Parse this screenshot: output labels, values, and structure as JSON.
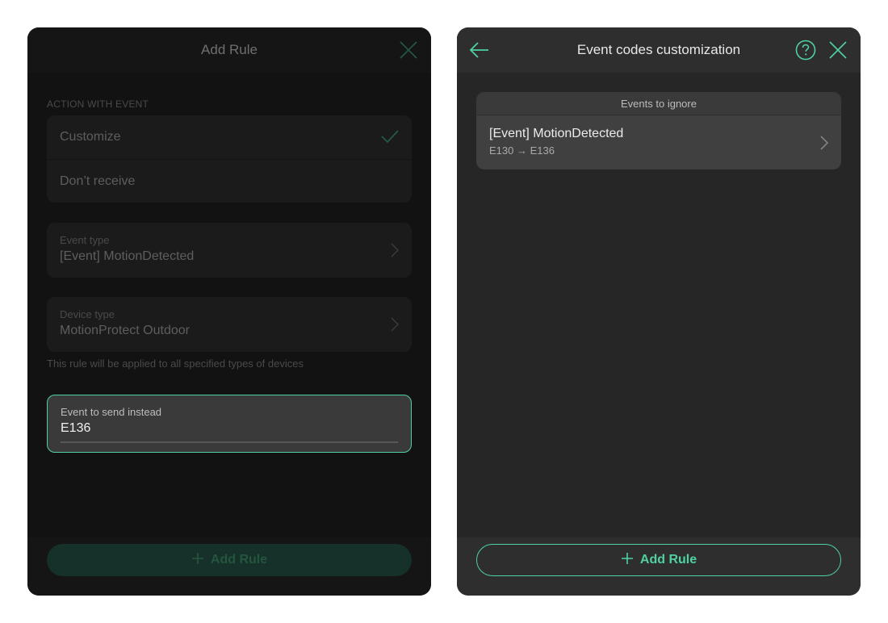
{
  "add_rule_panel": {
    "title": "Add Rule",
    "section_label": "ACTION WITH EVENT",
    "options": [
      {
        "label": "Customize",
        "selected": true
      },
      {
        "label": "Don’t receive",
        "selected": false
      }
    ],
    "event_type": {
      "label": "Event type",
      "value": "[Event] MotionDetected"
    },
    "device_type": {
      "label": "Device type",
      "value": "MotionProtect Outdoor"
    },
    "hint": "This rule will be applied to all specified types of devices",
    "send_instead": {
      "label": "Event to send instead",
      "value": "E136"
    },
    "add_button": "Add Rule"
  },
  "customization_panel": {
    "title": "Event codes customization",
    "group_header": "Events to ignore",
    "events": [
      {
        "name": "[Event] MotionDetected",
        "mapping": "E130 → E136"
      }
    ],
    "add_button": "Add Rule"
  },
  "colors": {
    "accent": "#4fd1a0",
    "panel_dark": "#121212",
    "panel": "#262626"
  },
  "icons": [
    "close-icon",
    "back-arrow-icon",
    "help-icon",
    "check-icon",
    "chevron-right-icon",
    "plus-icon"
  ]
}
